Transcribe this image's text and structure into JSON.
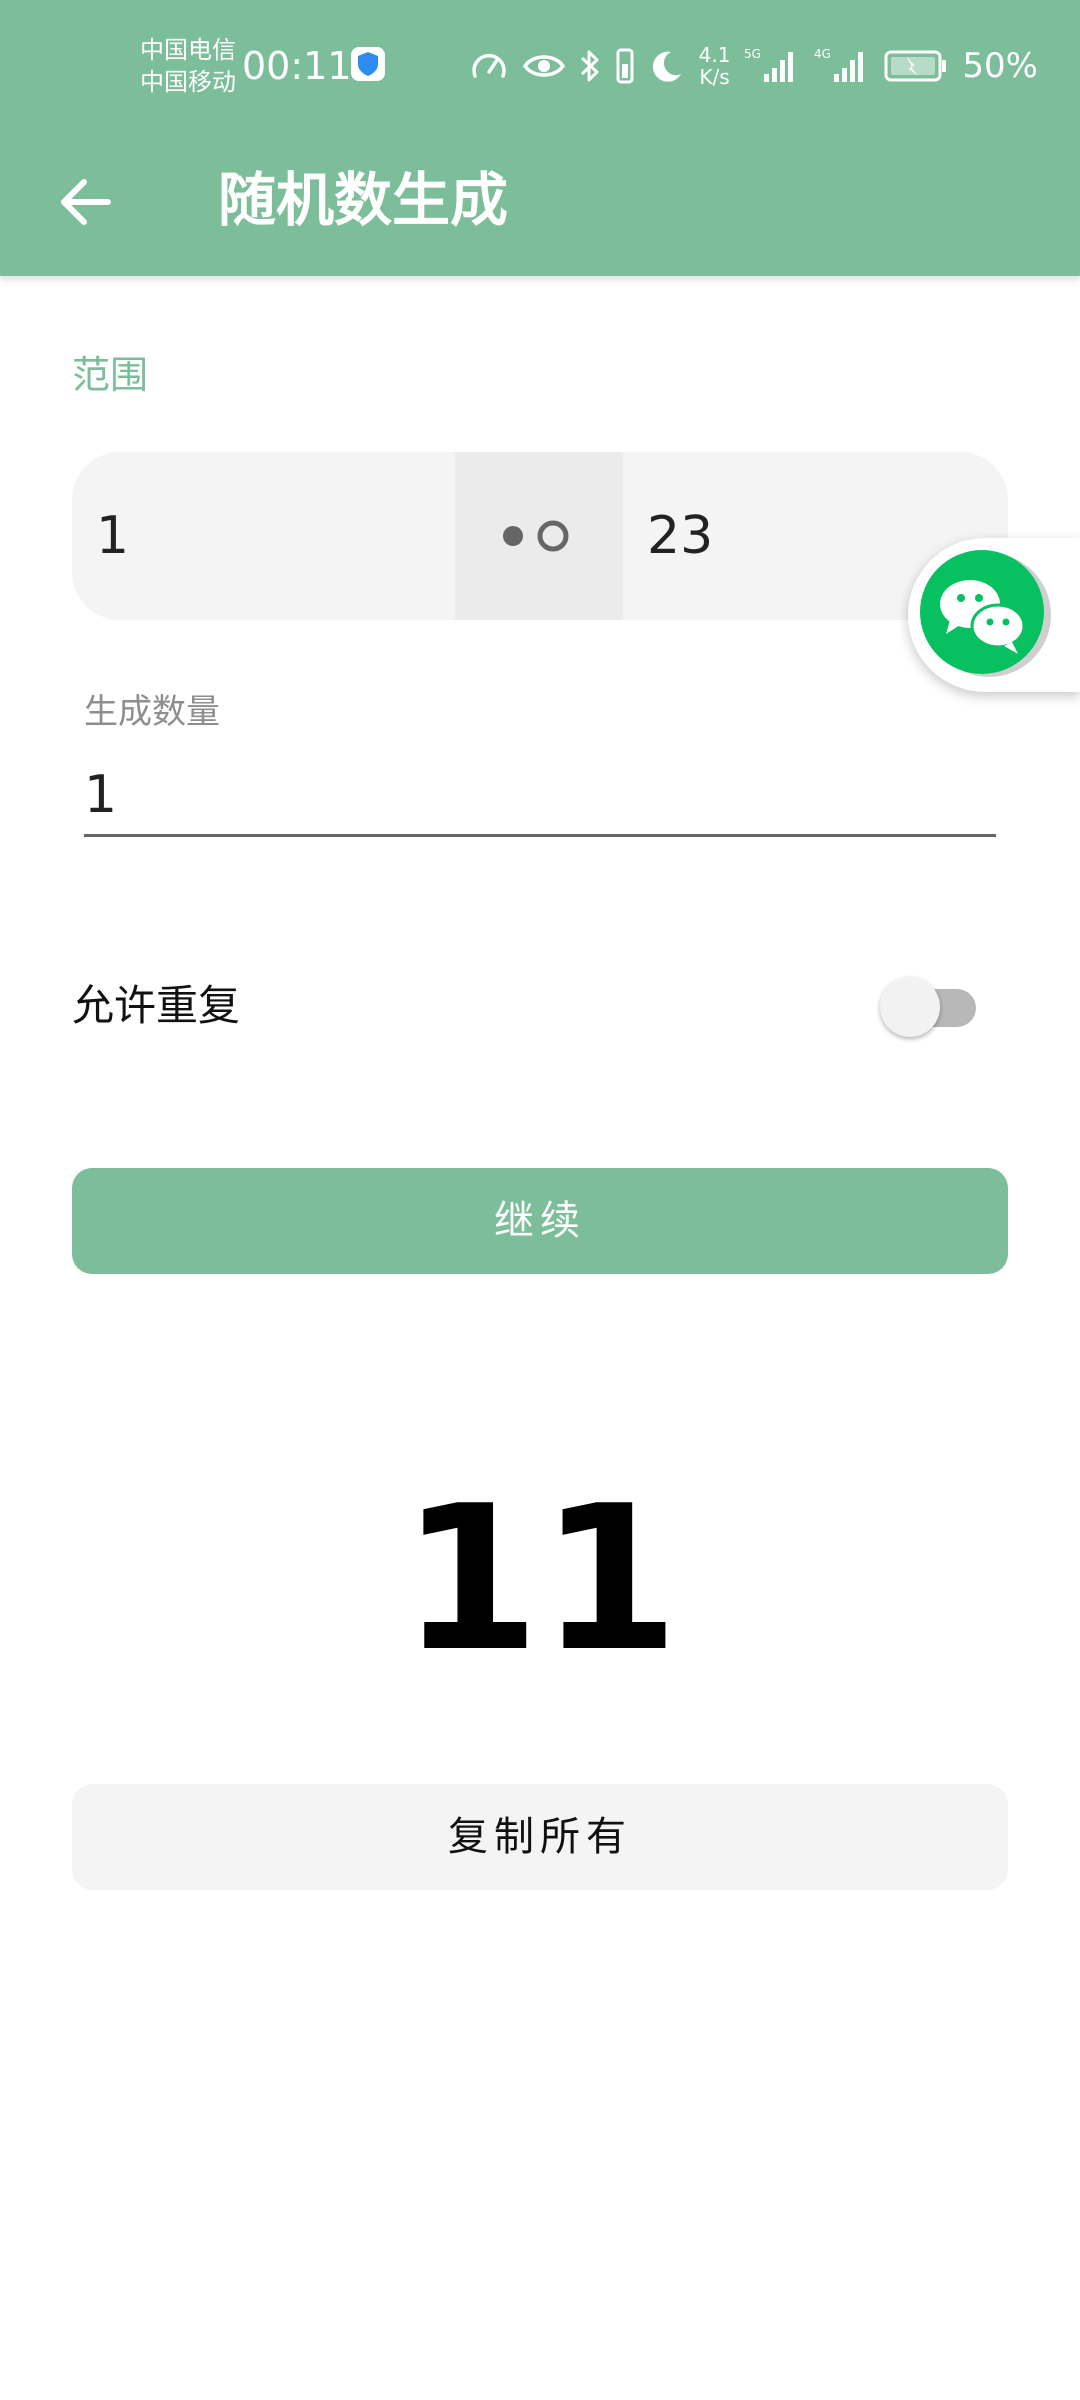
{
  "status_bar": {
    "carrier_1": "中国电信",
    "carrier_2": "中国移动",
    "time": "00:11",
    "net_speed_value": "4.1",
    "net_speed_unit": "K/s",
    "sim1_type": "5G",
    "sim2_type": "4G",
    "battery_percent": "50%",
    "icons": [
      "shield-icon",
      "speedometer-icon",
      "eye-icon",
      "bluetooth-icon",
      "vibrate-icon",
      "moon-icon",
      "signal-icon",
      "battery-charging-icon"
    ]
  },
  "toolbar": {
    "title": "随机数生成",
    "back_icon": "arrow-left-icon"
  },
  "range": {
    "label": "范围",
    "min": "1",
    "max": "23",
    "separator_icon": "range-separator-icon"
  },
  "count": {
    "label": "生成数量",
    "value": "1"
  },
  "repeat": {
    "label": "允许重复",
    "enabled": false
  },
  "continue_button": {
    "label": "继续"
  },
  "result": {
    "value": "11"
  },
  "copy_button": {
    "label": "复制所有"
  },
  "floating_bubble": {
    "icon": "wechat-icon"
  },
  "colors": {
    "accent": "#7DBE9A",
    "field_bg": "#F4F4F4",
    "wechat_green": "#07C160"
  }
}
